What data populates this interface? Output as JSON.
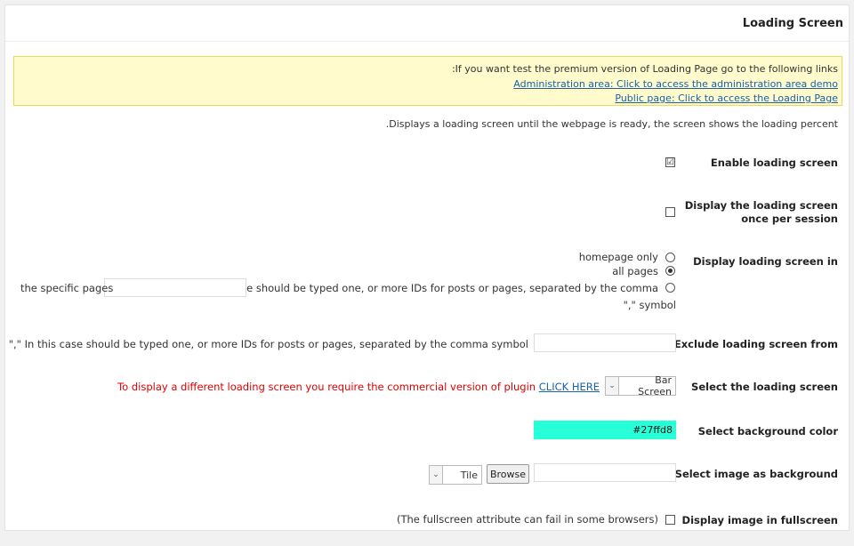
{
  "header": {
    "title": "Loading Screen"
  },
  "notice": {
    "intro": ":If you want test the premium version of Loading Page go to the following links",
    "admin_link": "Administration area: Click to access the administration area demo",
    "public_link": "Public page: Click to access the Loading Page"
  },
  "description": ".Displays a loading screen until the webpage is ready, the screen shows the loading percent",
  "enable": {
    "label": "Enable loading screen",
    "checked": true,
    "mark": "☑"
  },
  "once_per_session": {
    "label_line1": "Display the loading screen",
    "label_line2": "once per session",
    "checked": false
  },
  "display_in": {
    "label": "Display loading screen in",
    "options": [
      {
        "label": "homepage only",
        "selected": false
      },
      {
        "label": "all pages",
        "selected": true
      },
      {
        "label": "the specific pages",
        "selected": false
      }
    ],
    "specific_hint": "In this case should be typed one, or more IDs for posts or pages, separated by the comma",
    "specific_hint_2": "\",\" symbol",
    "specific_value": ""
  },
  "exclude": {
    "label": "Exclude loading screen from",
    "hint": "\",\" In this case should be typed one, or more IDs for posts or pages, separated by the comma symbol",
    "value": ""
  },
  "select_screen": {
    "label": "Select the loading screen",
    "notice": "To display a different loading screen you require the commercial version of plugin",
    "link": "CLICK HERE",
    "value": "Bar Screen"
  },
  "bg_color": {
    "label": "Select background color",
    "value": "#27ffd8",
    "swatch": "#27ffd8"
  },
  "bg_image": {
    "label": "Select image as background",
    "browse": "Browse",
    "repeat_value": "Tile",
    "value": ""
  },
  "fullscreen": {
    "label": "Display image in fullscreen",
    "hint": "(The fullscreen attribute can fail in some browsers)",
    "checked": false
  },
  "colors": {
    "notice_bg": "#fffbcc",
    "notice_border": "#e6db55",
    "link": "#1a61a6",
    "warning": "#e00000"
  },
  "icons": {
    "select_arrow": "chevron-down-icon",
    "checkbox_check": "check-icon"
  }
}
